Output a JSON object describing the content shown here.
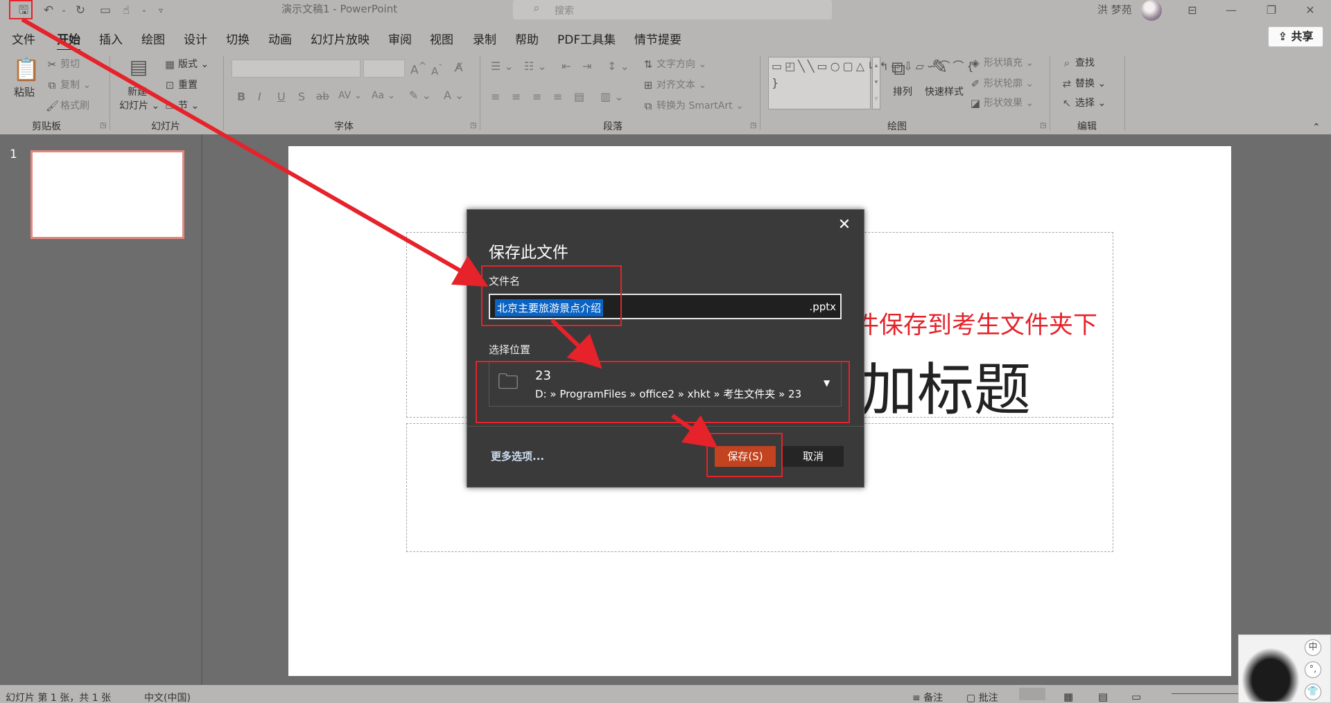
{
  "titlebar": {
    "title": "演示文稿1  -  PowerPoint",
    "search_placeholder": "搜索",
    "user_name": "洪 梦苑"
  },
  "menu": {
    "items": [
      "文件",
      "开始",
      "插入",
      "绘图",
      "设计",
      "切换",
      "动画",
      "幻灯片放映",
      "审阅",
      "视图",
      "录制",
      "帮助",
      "PDF工具集",
      "情节提要"
    ],
    "active": "开始",
    "share": "共享"
  },
  "ribbon": {
    "clipboard": {
      "paste": "粘贴",
      "cut": "剪切",
      "copy": "复制",
      "format_painter": "格式刷",
      "label": "剪贴板"
    },
    "slides": {
      "new_slide": "新建",
      "new_slide_2": "幻灯片",
      "layout": "版式",
      "reset": "重置",
      "section": "节",
      "label": "幻灯片"
    },
    "font": {
      "label": "字体",
      "bold": "B",
      "italic": "I",
      "underline": "U",
      "shadow": "S",
      "strike": "ab",
      "spacing": "AV",
      "case": "Aa"
    },
    "paragraph": {
      "text_direction": "文字方向",
      "align_text": "对齐文本",
      "smartart": "转换为 SmartArt",
      "label": "段落"
    },
    "drawing": {
      "arrange": "排列",
      "quick_styles": "快速样式",
      "shape_fill": "形状填充",
      "shape_outline": "形状轮廓",
      "shape_effects": "形状效果",
      "label": "绘图"
    },
    "editing": {
      "find": "查找",
      "replace": "替换",
      "select": "选择",
      "label": "编辑"
    }
  },
  "thumbnails": {
    "slide_number": "1"
  },
  "slide": {
    "instruction": "文件保存到考生文件夹下",
    "title_partial": "加标题"
  },
  "dialog": {
    "title": "保存此文件",
    "filename_label": "文件名",
    "filename_value": "北京主要旅游景点介绍",
    "extension": ".pptx",
    "location_label": "选择位置",
    "location_name": "23",
    "location_path": "D: » ProgramFiles » office2 » xhkt » 考生文件夹 » 23",
    "more_options": "更多选项...",
    "save": "保存(S)",
    "cancel": "取消"
  },
  "statusbar": {
    "slide_info": "幻灯片 第 1 张，共 1 张",
    "language": "中文(中国)",
    "notes": "备注",
    "comments": "批注"
  },
  "ime": {
    "mode": "中",
    "punct": "°,",
    "shirt": "👕"
  },
  "colors": {
    "annotation_red": "#e6222a",
    "save_button": "#c2431f",
    "selection_blue": "#0a63c4",
    "chrome_gray": "#b8b6b4"
  }
}
